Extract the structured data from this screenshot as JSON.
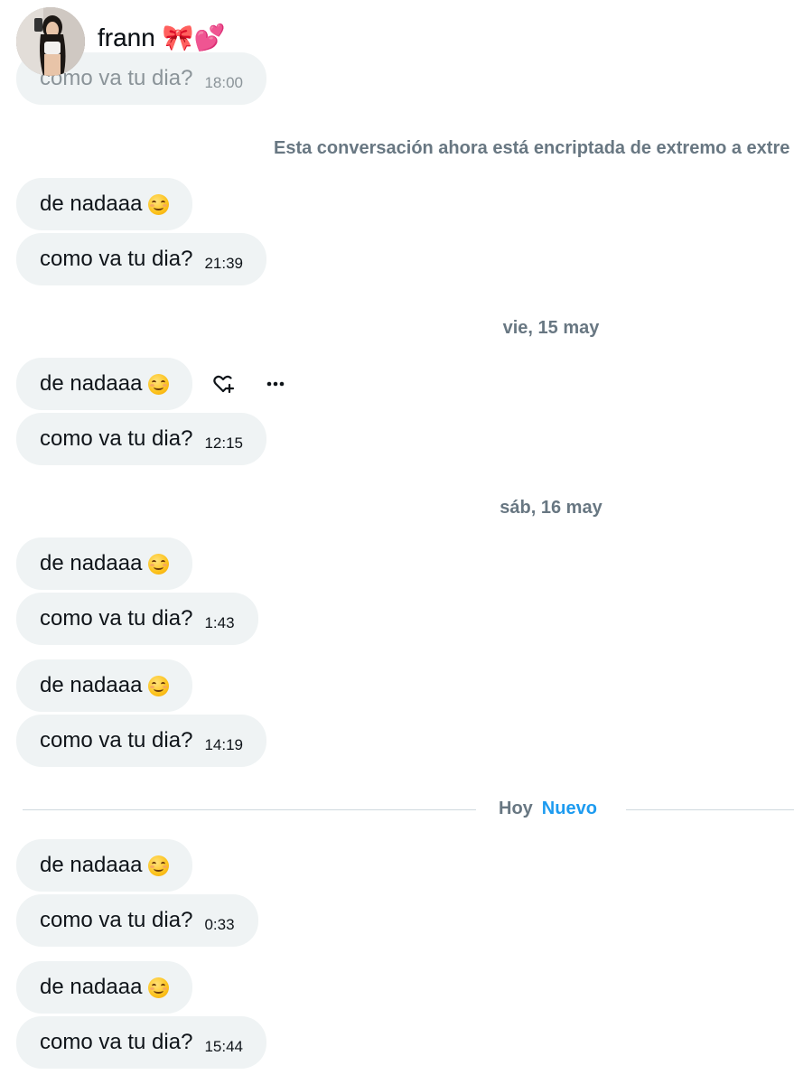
{
  "header": {
    "contact_name": "frann 🎀💕"
  },
  "encryption_notice": "Esta conversación ahora está encriptada de extremo a extre",
  "date_separators": {
    "vie": "vie, 15 may",
    "sab": "sáb, 16 may",
    "today": "Hoy",
    "new_label": "Nuevo"
  },
  "messages": [
    {
      "text": "como va tu dia?",
      "time": "18:00"
    },
    {
      "text": "de nadaaa",
      "time": ""
    },
    {
      "text": "como va tu dia?",
      "time": "21:39"
    },
    {
      "text": "de nadaaa",
      "time": ""
    },
    {
      "text": "como va tu dia?",
      "time": "12:15"
    },
    {
      "text": "de nadaaa",
      "time": ""
    },
    {
      "text": "como va tu dia?",
      "time": "1:43"
    },
    {
      "text": "de nadaaa",
      "time": ""
    },
    {
      "text": "como va tu dia?",
      "time": "14:19"
    },
    {
      "text": "de nadaaa",
      "time": ""
    },
    {
      "text": "como va tu dia?",
      "time": "0:33"
    },
    {
      "text": "de nadaaa",
      "time": ""
    },
    {
      "text": "como va tu dia?",
      "time": "15:44"
    }
  ],
  "icons": {
    "react": "heart-plus-icon",
    "more": "more-horizontal-icon",
    "emoji": "smiling-face-emoji"
  }
}
